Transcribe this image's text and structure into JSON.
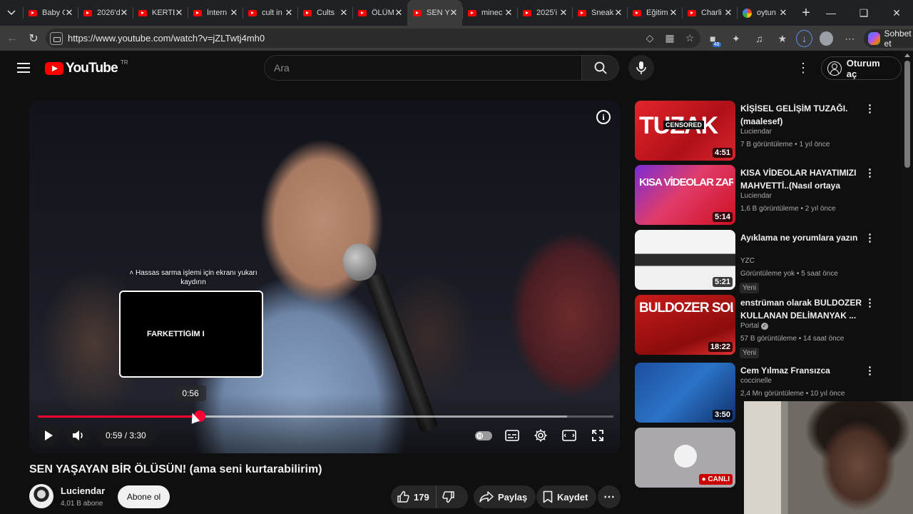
{
  "browser": {
    "tabs": [
      {
        "title": "Baby C",
        "icon": "youtube-icon"
      },
      {
        "title": "2026'd",
        "icon": "youtube-icon"
      },
      {
        "title": "KERTB",
        "icon": "youtube-icon"
      },
      {
        "title": "İntern",
        "icon": "youtube-icon"
      },
      {
        "title": "cult in",
        "icon": "youtube-icon"
      },
      {
        "title": "Cults",
        "icon": "youtube-icon"
      },
      {
        "title": "ÖLÜM",
        "icon": "youtube-icon"
      },
      {
        "title": "SEN Y",
        "icon": "youtube-icon",
        "active": true
      },
      {
        "title": "minec",
        "icon": "youtube-icon"
      },
      {
        "title": "2025'i",
        "icon": "youtube-icon"
      },
      {
        "title": "Sneak",
        "icon": "youtube-icon"
      },
      {
        "title": "Eğitim",
        "icon": "youtube-icon"
      },
      {
        "title": "Charli",
        "icon": "youtube-icon"
      },
      {
        "title": "oytun",
        "icon": "google-icon"
      }
    ],
    "url": "https://www.youtube.com/watch?v=jZLTwtj4mh0",
    "copilot_label": "Sohbet et"
  },
  "masthead": {
    "country_code": "TR",
    "logo_text": "YouTube",
    "search_placeholder": "Ara",
    "signin_label": "Oturum aç"
  },
  "player": {
    "seek_hint": "Hassas sarma işlemi için ekranı yukarı kaydırın",
    "preview_text": "FARKETTİĞİM KA",
    "preview_time": "0:56",
    "current_time": "0:59",
    "duration": "3:30",
    "time_display": "0:59 / 3:30",
    "progress_fraction": 0.281,
    "buffered_fraction": 0.92,
    "accent": "#ff0033"
  },
  "video": {
    "title": "SEN YAŞAYAN BİR ÖLÜSÜN! (ama seni kurtarabilirim)",
    "channel": "Luciendar",
    "subscribers": "4,01 B abone",
    "subscribe_label": "Abone ol",
    "likes": "179",
    "share_label": "Paylaş",
    "save_label": "Kaydet"
  },
  "recommendations": [
    {
      "title": "KİŞİSEL GELİŞİM TUZAĞI. (maalesef)",
      "channel": "Luciendar",
      "views": "7 B görüntüleme",
      "age": "1 yıl önce",
      "duration": "4:51",
      "thumb_text": "TUZAK",
      "thumb_tag": "CENSORED"
    },
    {
      "title": "KISA VİDEOLAR HAYATIMIZI MAHVETTİ..(Nasıl ortaya çıktı?)",
      "channel": "Luciendar",
      "views": "1,6 B görüntüleme",
      "age": "2 yıl önce",
      "duration": "5:14",
      "thumb_text": "KISA VİDEOLAR ZARARLI"
    },
    {
      "title": "Ayıklama ne yorumlara yazın",
      "channel": "YZC",
      "views": "Görüntüleme yok",
      "age": "5 saat önce",
      "duration": "5:21",
      "badge": "Yeni"
    },
    {
      "title": "enstrüman olarak BULDOZER KULLANAN DELİMANYAK ...",
      "channel": "Portal",
      "views": "57 B görüntüleme",
      "age": "14 saat önce",
      "duration": "18:22",
      "badge": "Yeni",
      "thumb_text": "BULDOZER SOLO",
      "verified": true
    },
    {
      "title": "Cem Yılmaz Fransızca",
      "channel": "coccinelle",
      "views": "2,4 Mn görüntüleme",
      "age": "10 yıl önce",
      "duration": "3:50"
    },
    {
      "title": "",
      "channel": "",
      "views": "",
      "age": "",
      "live_label": "CANLI"
    }
  ]
}
